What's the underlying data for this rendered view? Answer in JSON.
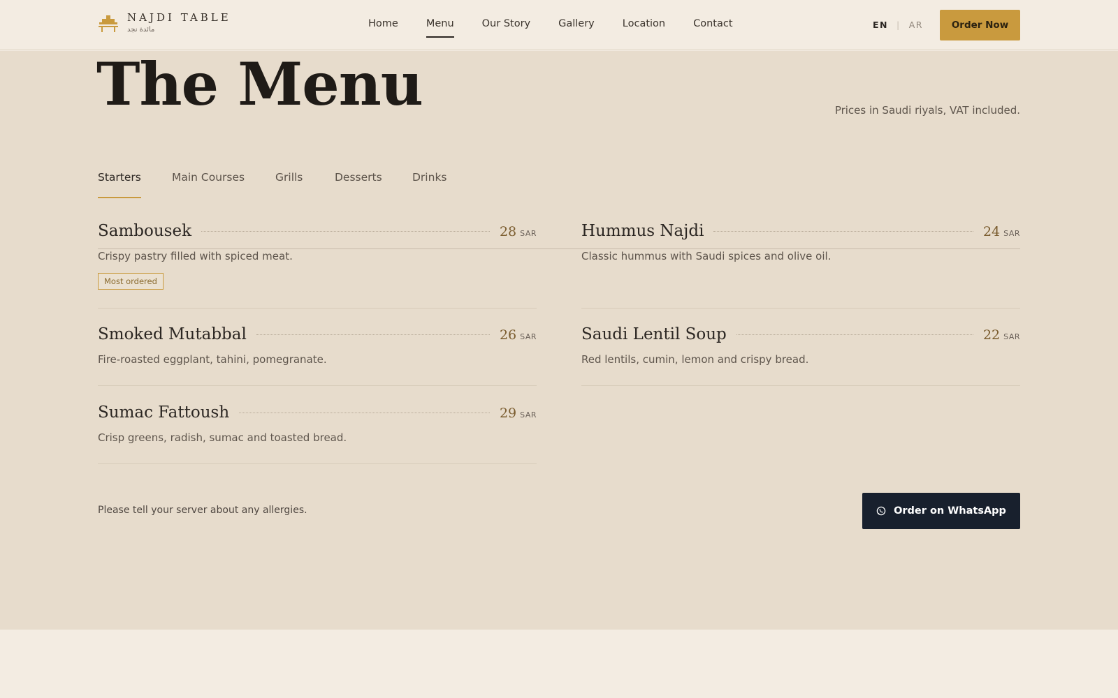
{
  "brand": {
    "name": "NAJDI TABLE",
    "arabic_name": "مائدة نجد",
    "logo_icon": "table-icon",
    "accent_color": "#c99a3e"
  },
  "nav": {
    "items": [
      {
        "label": "Home"
      },
      {
        "label": "Menu",
        "active": true
      },
      {
        "label": "Our Story"
      },
      {
        "label": "Gallery"
      },
      {
        "label": "Location"
      },
      {
        "label": "Contact"
      }
    ]
  },
  "lang": {
    "en": "EN",
    "ar": "AR",
    "active": "EN"
  },
  "header": {
    "order_label": "Order Now"
  },
  "page": {
    "title": "The Menu",
    "prices_note": "Prices in Saudi riyals, VAT included."
  },
  "tabs": [
    {
      "label": "Starters",
      "active": true
    },
    {
      "label": "Main Courses"
    },
    {
      "label": "Grills"
    },
    {
      "label": "Desserts"
    },
    {
      "label": "Drinks"
    }
  ],
  "menu_items": [
    {
      "name": "Sambousek",
      "price": "28",
      "currency": "SAR",
      "desc": "Crispy pastry filled with spiced meat.",
      "badge": "Most ordered"
    },
    {
      "name": "Hummus Najdi",
      "price": "24",
      "currency": "SAR",
      "desc": "Classic hummus with Saudi spices and olive oil."
    },
    {
      "name": "Smoked Mutabbal",
      "price": "26",
      "currency": "SAR",
      "desc": "Fire-roasted eggplant, tahini, pomegranate."
    },
    {
      "name": "Saudi Lentil Soup",
      "price": "22",
      "currency": "SAR",
      "desc": "Red lentils, cumin, lemon and crispy bread."
    },
    {
      "name": "Sumac Fattoush",
      "price": "29",
      "currency": "SAR",
      "desc": "Crisp greens, radish, sumac and toasted bread."
    }
  ],
  "footer": {
    "allergy_note": "Please tell your server about any allergies.",
    "whatsapp_label": "Order on WhatsApp",
    "whatsapp_icon": "whatsapp-icon"
  }
}
